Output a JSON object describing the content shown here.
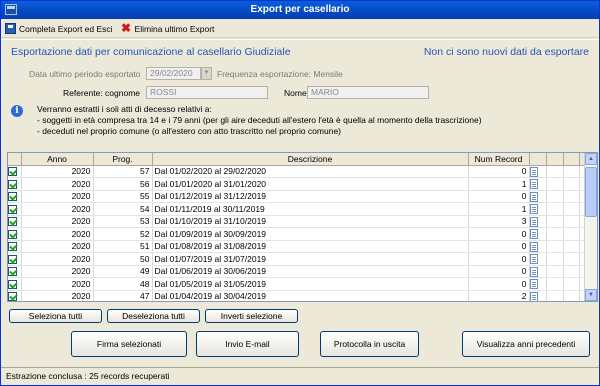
{
  "window": {
    "title": "Export per casellario"
  },
  "toolbar": {
    "complete_label": "Completa Export ed Esci",
    "delete_label": "Elimina ultimo Export"
  },
  "header": {
    "left": "Esportazione dati per comunicazione al casellario Giudiziale",
    "right": "Non ci sono nuovi dati da esportare"
  },
  "form": {
    "last_period_label": "Data ultimo periodo esportato",
    "last_period_value": "29/02/2020",
    "frequency_label": "Frequenza esportazione: Mensile",
    "ref_surname_label": "Referente: cognome",
    "ref_surname_value": "ROSSI",
    "name_label": "Nome",
    "name_value": "MARIO"
  },
  "info": {
    "line1": "Verranno estratti i soli atti di decesso relativi a:",
    "line2": "- soggetti in età compresa tra 14 e i 79 anni (per gli aire deceduti all'estero l'età è quella al momento della trascrizione)",
    "line3": "- deceduti nel proprio comune (o all'estero con atto trascritto nel proprio comune)"
  },
  "table": {
    "headers": {
      "anno": "Anno",
      "prog": "Prog.",
      "descrizione": "Descrizione",
      "num_record": "Num Record"
    },
    "rows": [
      {
        "anno": "2020",
        "prog": "57",
        "descrizione": "Dal 01/02/2020 al 29/02/2020",
        "num": "0"
      },
      {
        "anno": "2020",
        "prog": "56",
        "descrizione": "Dal 01/01/2020 al 31/01/2020",
        "num": "1"
      },
      {
        "anno": "2020",
        "prog": "55",
        "descrizione": "Dal 01/12/2019 al 31/12/2019",
        "num": "0"
      },
      {
        "anno": "2020",
        "prog": "54",
        "descrizione": "Dal 01/11/2019 al 30/11/2019",
        "num": "1"
      },
      {
        "anno": "2020",
        "prog": "53",
        "descrizione": "Dal 01/10/2019 al 31/10/2019",
        "num": "3"
      },
      {
        "anno": "2020",
        "prog": "52",
        "descrizione": "Dal 01/09/2019 al 30/09/2019",
        "num": "0"
      },
      {
        "anno": "2020",
        "prog": "51",
        "descrizione": "Dal 01/08/2019 al 31/08/2019",
        "num": "0"
      },
      {
        "anno": "2020",
        "prog": "50",
        "descrizione": "Dal 01/07/2019 al 31/07/2019",
        "num": "0"
      },
      {
        "anno": "2020",
        "prog": "49",
        "descrizione": "Dal 01/06/2019 al 30/06/2019",
        "num": "0"
      },
      {
        "anno": "2020",
        "prog": "48",
        "descrizione": "Dal 01/05/2019 al 31/05/2019",
        "num": "0"
      },
      {
        "anno": "2020",
        "prog": "47",
        "descrizione": "Dal 01/04/2019 al 30/04/2019",
        "num": "2"
      }
    ]
  },
  "selection_buttons": {
    "select_all": "Seleziona tutti",
    "deselect_all": "Deseleziona tutti",
    "invert": "Inverti selezione"
  },
  "action_buttons": {
    "sign": "Firma selezionati",
    "email": "Invio E-mail",
    "protocol": "Protocolla in uscita",
    "previous_years": "Visualizza anni precedenti"
  },
  "status": {
    "text": "Estrazione conclusa : 25 records recuperati"
  }
}
